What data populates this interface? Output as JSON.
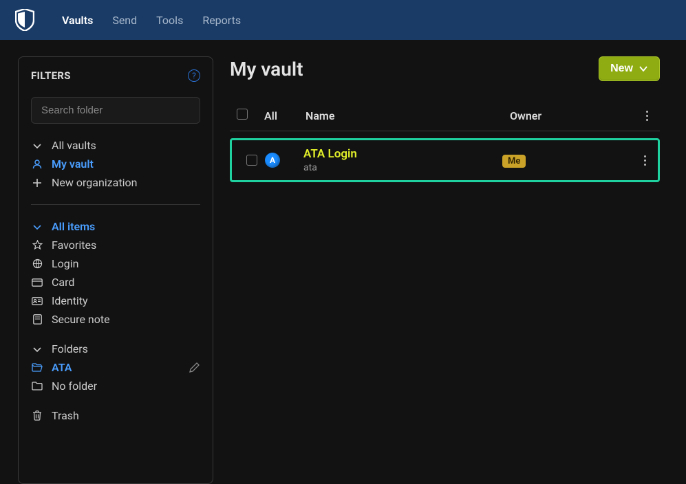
{
  "nav": {
    "items": [
      {
        "label": "Vaults",
        "active": true
      },
      {
        "label": "Send",
        "active": false
      },
      {
        "label": "Tools",
        "active": false
      },
      {
        "label": "Reports",
        "active": false
      }
    ]
  },
  "sidebar": {
    "title": "FILTERS",
    "search_placeholder": "Search folder",
    "vaults": {
      "all": "All vaults",
      "my": "My vault",
      "new_org": "New organization"
    },
    "items": {
      "all": "All items",
      "favorites": "Favorites",
      "login": "Login",
      "card": "Card",
      "identity": "Identity",
      "secure_note": "Secure note"
    },
    "folders": {
      "header": "Folders",
      "ata": "ATA",
      "no_folder": "No folder"
    },
    "trash": "Trash"
  },
  "main": {
    "title": "My vault",
    "new_button": "New",
    "columns": {
      "all": "All",
      "name": "Name",
      "owner": "Owner"
    },
    "rows": [
      {
        "icon_letter": "A",
        "name": "ATA Login",
        "subtitle": "ata",
        "owner": "Me"
      }
    ]
  }
}
